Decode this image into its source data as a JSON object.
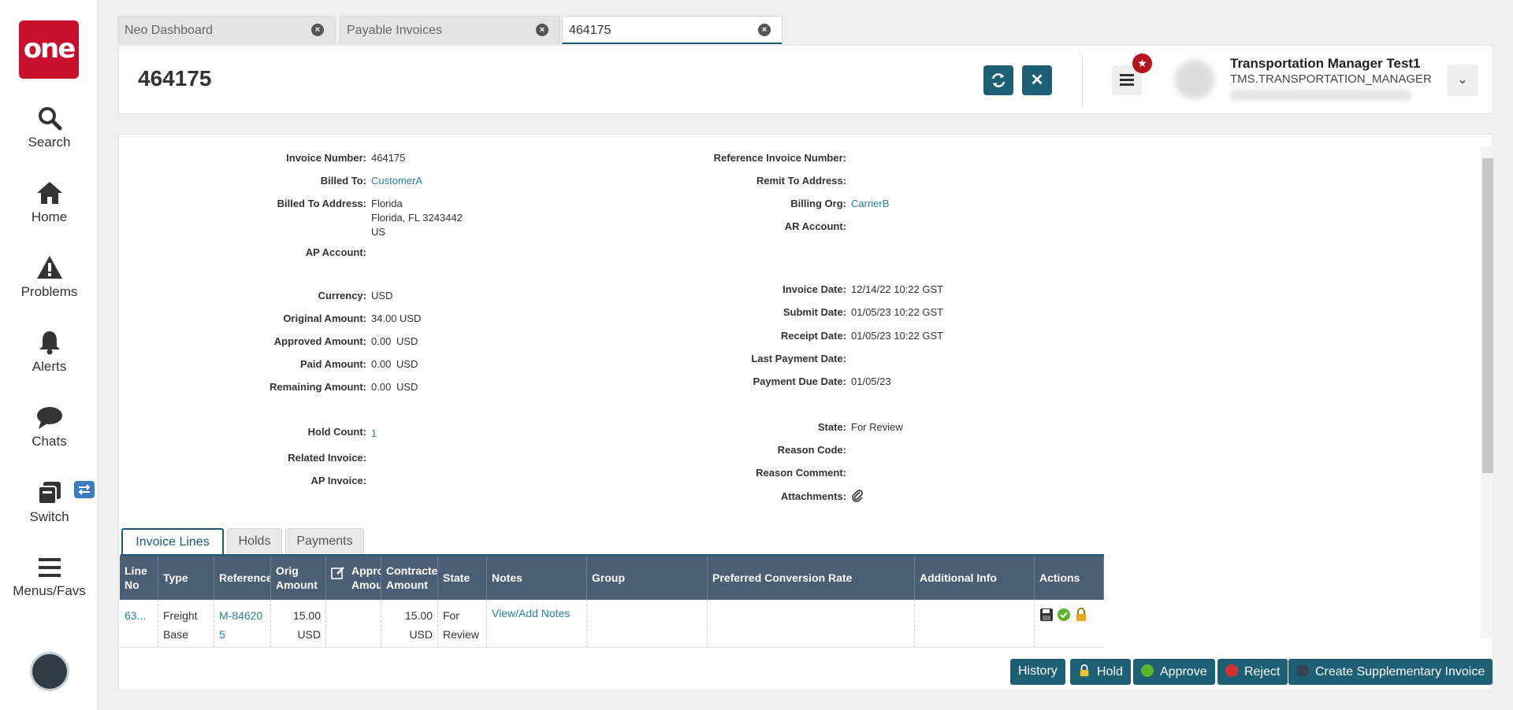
{
  "nav": {
    "logo": "one",
    "items": [
      {
        "label": "Search"
      },
      {
        "label": "Home"
      },
      {
        "label": "Problems"
      },
      {
        "label": "Alerts"
      },
      {
        "label": "Chats"
      },
      {
        "label": "Switch"
      },
      {
        "label": "Menus/Favs"
      }
    ]
  },
  "tabs": [
    {
      "label": "Neo Dashboard"
    },
    {
      "label": "Payable Invoices"
    },
    {
      "label": "464175"
    }
  ],
  "header": {
    "title": "464175",
    "user_name": "Transportation Manager Test1",
    "user_role": "TMS.TRANSPORTATION_MANAGER"
  },
  "details": {
    "invoice_number_label": "Invoice Number:",
    "invoice_number": "464175",
    "billed_to_label": "Billed To:",
    "billed_to": "CustomerA",
    "billed_to_address_label": "Billed To Address:",
    "address_line1": "Florida",
    "address_line2": "Florida, FL 3243442",
    "address_line3": "US",
    "ap_account_label": "AP Account:",
    "currency_label": "Currency:",
    "currency": "USD",
    "original_amount_label": "Original Amount:",
    "original_amount": "34.00",
    "approved_amount_label": "Approved Amount:",
    "approved_amount": "0.00",
    "paid_amount_label": "Paid Amount:",
    "paid_amount": "0.00",
    "remaining_amount_label": "Remaining Amount:",
    "remaining_amount": "0.00",
    "unit": "USD",
    "hold_count_label": "Hold Count:",
    "hold_count": "1",
    "related_invoice_label": "Related Invoice:",
    "ap_invoice_label": "AP Invoice:",
    "reference_invoice_number_label": "Reference Invoice Number:",
    "remit_to_address_label": "Remit To Address:",
    "billing_org_label": "Billing Org:",
    "billing_org": "CarrierB",
    "ar_account_label": "AR Account:",
    "invoice_date_label": "Invoice Date:",
    "invoice_date": "12/14/22 10:22 GST",
    "submit_date_label": "Submit Date:",
    "submit_date": "01/05/23 10:22 GST",
    "receipt_date_label": "Receipt Date:",
    "receipt_date": "01/05/23 10:22 GST",
    "last_payment_date_label": "Last Payment Date:",
    "payment_due_date_label": "Payment Due Date:",
    "payment_due_date": "01/05/23",
    "state_label": "State:",
    "state": "For Review",
    "reason_code_label": "Reason Code:",
    "reason_comment_label": "Reason Comment:",
    "attachments_label": "Attachments:"
  },
  "subtabs": [
    {
      "label": "Invoice Lines"
    },
    {
      "label": "Holds"
    },
    {
      "label": "Payments"
    }
  ],
  "grid": {
    "columns": [
      "Line No",
      "Type",
      "Reference",
      "Orig Amount",
      "Approved Amount",
      "Contracted Amount",
      "State",
      "Notes",
      "Group",
      "Preferred Conversion Rate",
      "Additional Info",
      "Actions"
    ],
    "rows": [
      {
        "line_no": "63...",
        "type": "Freight Base",
        "reference": "M-846205",
        "orig_amount": "15.00",
        "orig_unit": "USD",
        "approved_amount": "",
        "contracted_amount": "15.00",
        "contracted_unit": "USD",
        "state": "For Review",
        "notes": "View/Add Notes",
        "group": "",
        "conversion_rate": "",
        "additional_info": ""
      }
    ]
  },
  "footer": {
    "history": "History",
    "hold": "Hold",
    "approve": "Approve",
    "reject": "Reject",
    "create_supplementary": "Create Supplementary Invoice"
  },
  "colors": {
    "brand": "#c8102e",
    "primary_button": "#1d5f74",
    "grid_header": "#4a5e74",
    "link": "#2a7fa5"
  }
}
